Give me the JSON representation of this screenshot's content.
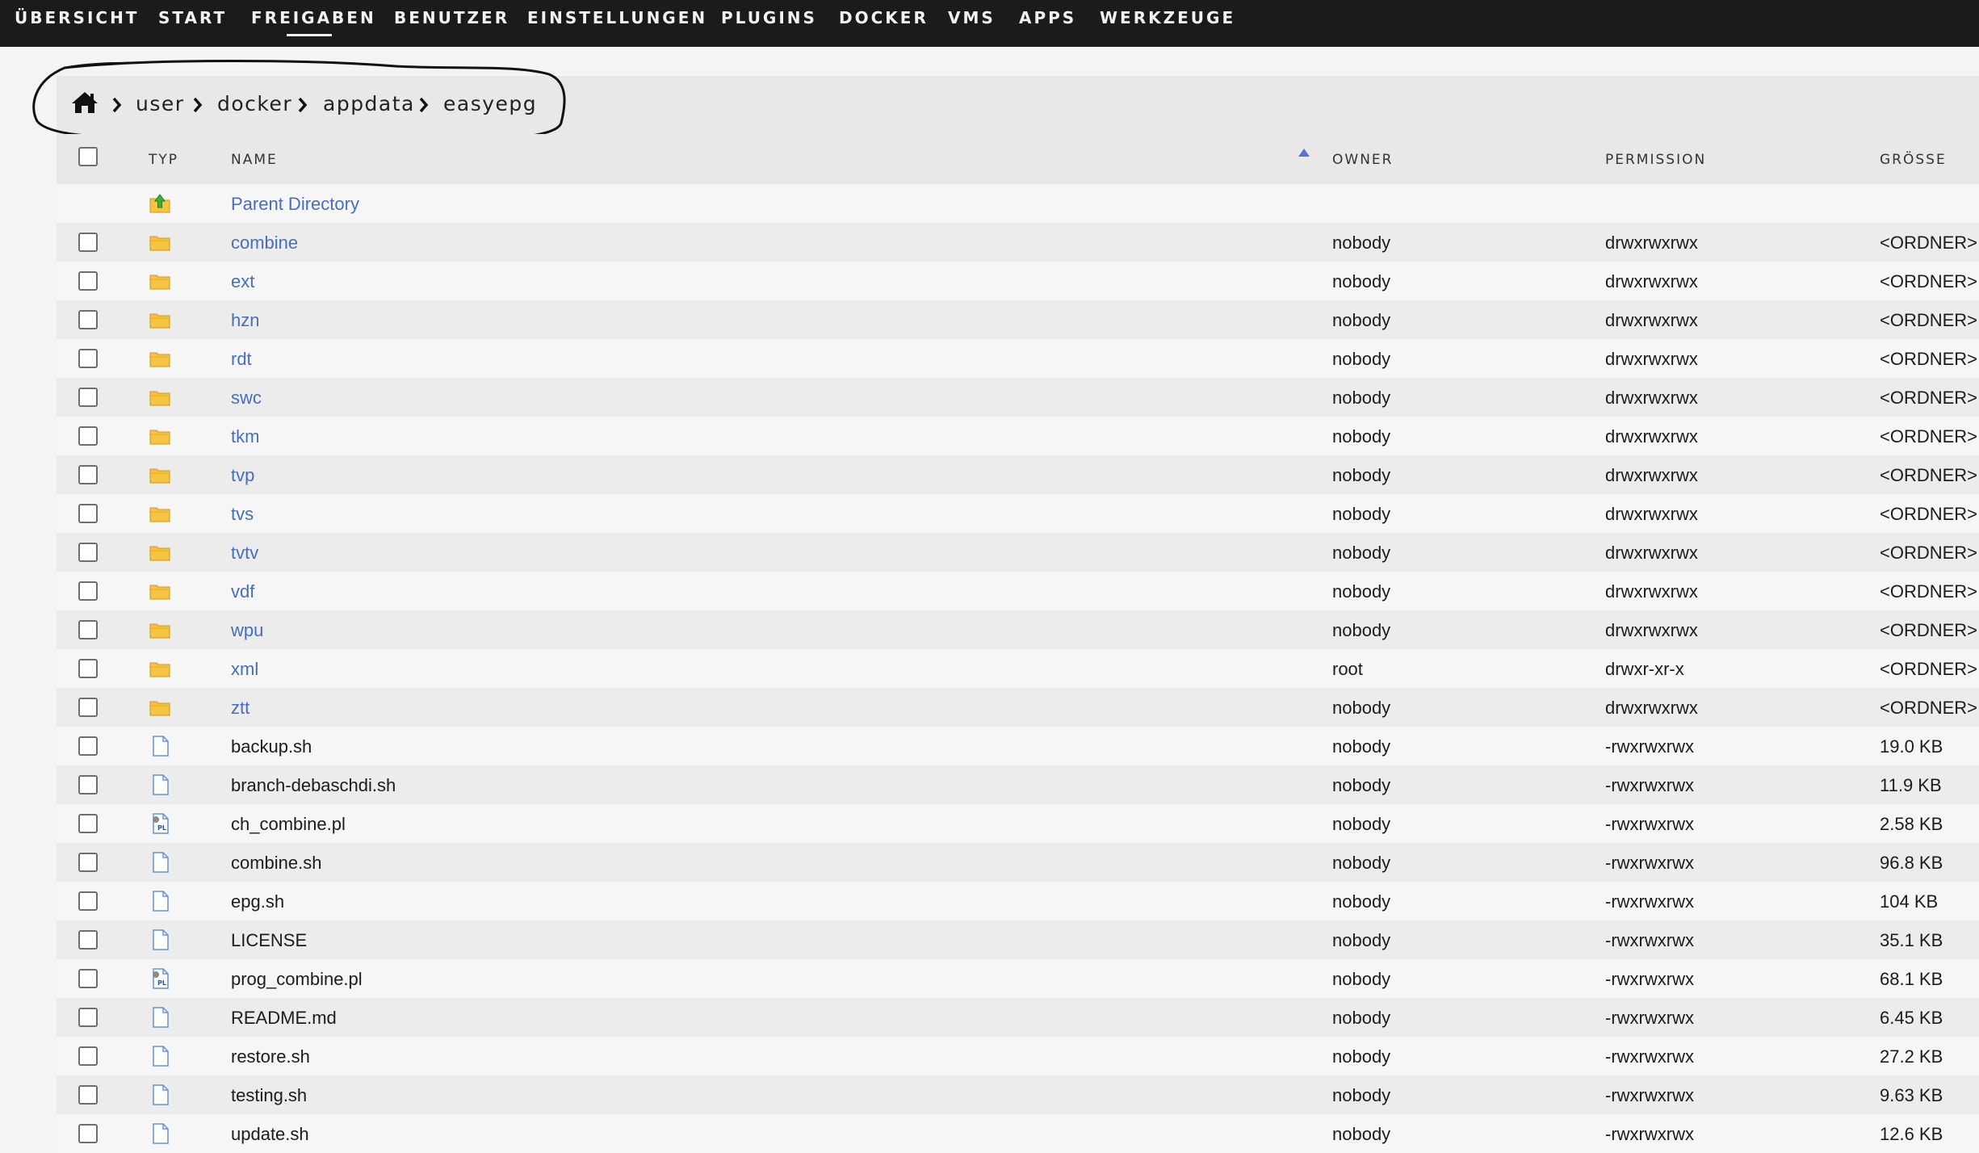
{
  "nav": {
    "items": [
      "ÜBERSICHT",
      "START",
      "FREIGABEN",
      "BENUTZER",
      "EINSTELLUNGEN",
      "PLUGINS",
      "DOCKER",
      "VMS",
      "APPS",
      "WERKZEUGE"
    ],
    "active": "FREIGABEN"
  },
  "breadcrumb": {
    "home_icon": "home-icon",
    "items": [
      "user",
      "docker",
      "appdata",
      "easyepg"
    ]
  },
  "table": {
    "columns": {
      "typ": "TYP",
      "name": "NAME",
      "owner": "OWNER",
      "permission": "PERMISSION",
      "size": "GRÖSSE"
    },
    "sort_column": "NAME",
    "sort_direction": "ascending",
    "parent": {
      "name": "Parent Directory",
      "icon": "folder-up-icon"
    },
    "rows": [
      {
        "type": "folder",
        "name": "combine",
        "owner": "nobody",
        "permission": "drwxrwxrwx",
        "size": "<ORDNER>"
      },
      {
        "type": "folder",
        "name": "ext",
        "owner": "nobody",
        "permission": "drwxrwxrwx",
        "size": "<ORDNER>"
      },
      {
        "type": "folder",
        "name": "hzn",
        "owner": "nobody",
        "permission": "drwxrwxrwx",
        "size": "<ORDNER>"
      },
      {
        "type": "folder",
        "name": "rdt",
        "owner": "nobody",
        "permission": "drwxrwxrwx",
        "size": "<ORDNER>"
      },
      {
        "type": "folder",
        "name": "swc",
        "owner": "nobody",
        "permission": "drwxrwxrwx",
        "size": "<ORDNER>"
      },
      {
        "type": "folder",
        "name": "tkm",
        "owner": "nobody",
        "permission": "drwxrwxrwx",
        "size": "<ORDNER>"
      },
      {
        "type": "folder",
        "name": "tvp",
        "owner": "nobody",
        "permission": "drwxrwxrwx",
        "size": "<ORDNER>"
      },
      {
        "type": "folder",
        "name": "tvs",
        "owner": "nobody",
        "permission": "drwxrwxrwx",
        "size": "<ORDNER>"
      },
      {
        "type": "folder",
        "name": "tvtv",
        "owner": "nobody",
        "permission": "drwxrwxrwx",
        "size": "<ORDNER>"
      },
      {
        "type": "folder",
        "name": "vdf",
        "owner": "nobody",
        "permission": "drwxrwxrwx",
        "size": "<ORDNER>"
      },
      {
        "type": "folder",
        "name": "wpu",
        "owner": "nobody",
        "permission": "drwxrwxrwx",
        "size": "<ORDNER>"
      },
      {
        "type": "folder",
        "name": "xml",
        "owner": "root",
        "permission": "drwxr-xr-x",
        "size": "<ORDNER>"
      },
      {
        "type": "folder",
        "name": "ztt",
        "owner": "nobody",
        "permission": "drwxrwxrwx",
        "size": "<ORDNER>"
      },
      {
        "type": "file",
        "name": "backup.sh",
        "owner": "nobody",
        "permission": "-rwxrwxrwx",
        "size": "19.0 KB"
      },
      {
        "type": "file",
        "name": "branch-debaschdi.sh",
        "owner": "nobody",
        "permission": "-rwxrwxrwx",
        "size": "11.9 KB"
      },
      {
        "type": "perl",
        "name": "ch_combine.pl",
        "owner": "nobody",
        "permission": "-rwxrwxrwx",
        "size": "2.58 KB"
      },
      {
        "type": "file",
        "name": "combine.sh",
        "owner": "nobody",
        "permission": "-rwxrwxrwx",
        "size": "96.8 KB"
      },
      {
        "type": "file",
        "name": "epg.sh",
        "owner": "nobody",
        "permission": "-rwxrwxrwx",
        "size": "104 KB"
      },
      {
        "type": "file",
        "name": "LICENSE",
        "owner": "nobody",
        "permission": "-rwxrwxrwx",
        "size": "35.1 KB"
      },
      {
        "type": "perl",
        "name": "prog_combine.pl",
        "owner": "nobody",
        "permission": "-rwxrwxrwx",
        "size": "68.1 KB"
      },
      {
        "type": "file",
        "name": "README.md",
        "owner": "nobody",
        "permission": "-rwxrwxrwx",
        "size": "6.45 KB"
      },
      {
        "type": "file",
        "name": "restore.sh",
        "owner": "nobody",
        "permission": "-rwxrwxrwx",
        "size": "27.2 KB"
      },
      {
        "type": "file",
        "name": "testing.sh",
        "owner": "nobody",
        "permission": "-rwxrwxrwx",
        "size": "9.63 KB"
      },
      {
        "type": "file",
        "name": "update.sh",
        "owner": "nobody",
        "permission": "-rwxrwxrwx",
        "size": "12.6 KB"
      }
    ]
  },
  "colors": {
    "nav_bg": "#1c1b1b",
    "nav_text": "#f2f2f2",
    "link": "#486dba",
    "sort_arrow": "#5b6fd6",
    "folder": "#f5c542",
    "row_alt": "#ececec"
  }
}
